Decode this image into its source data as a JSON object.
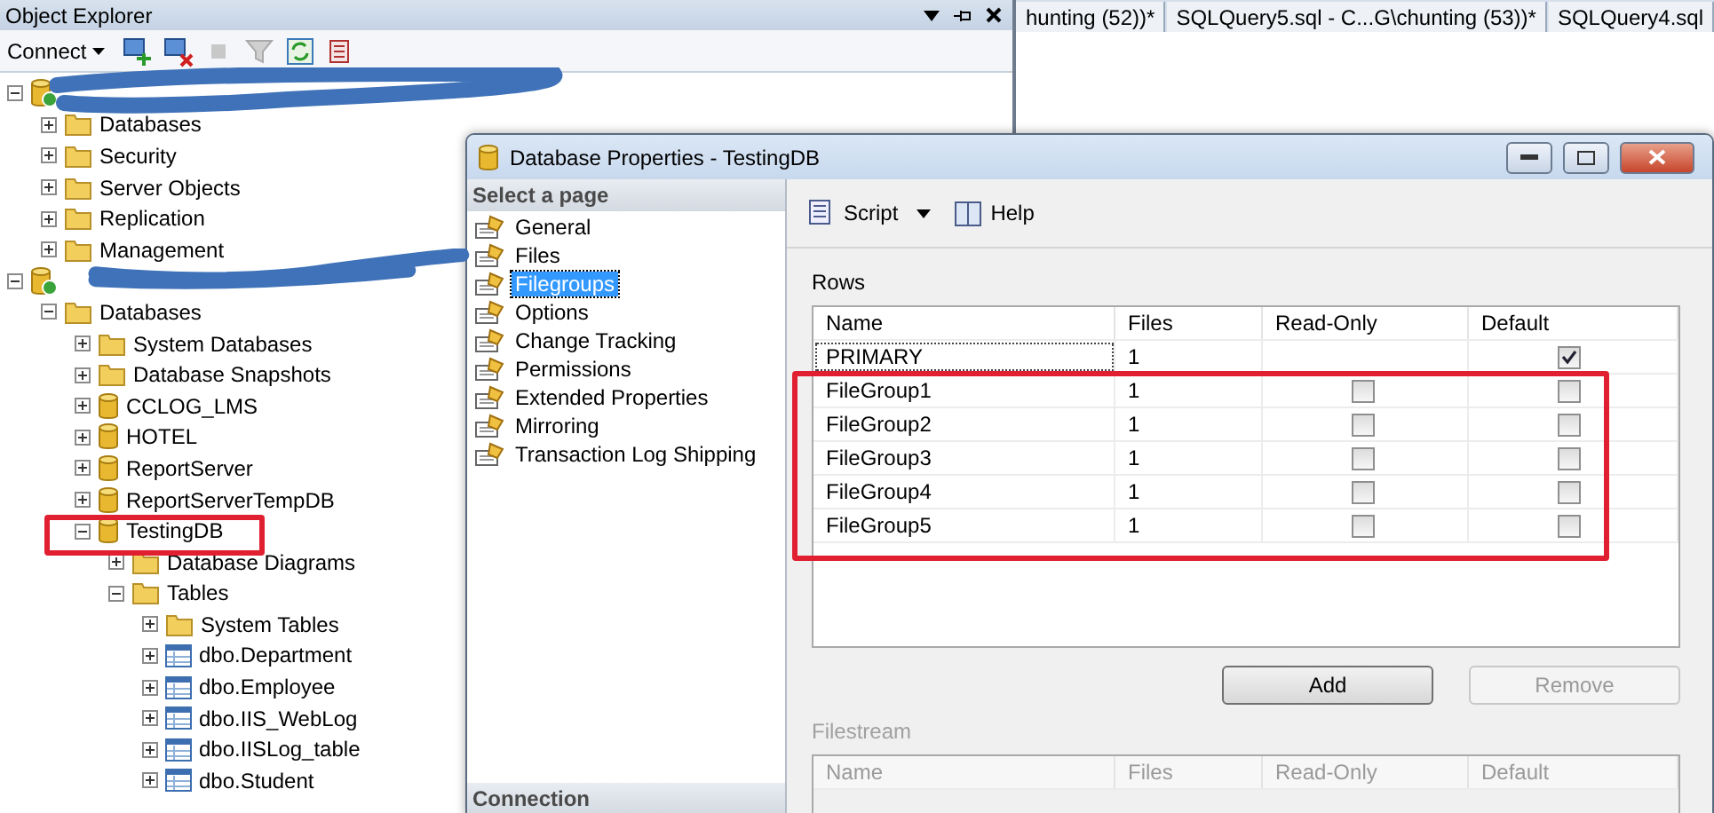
{
  "explorer": {
    "title": "Object Explorer",
    "connect_label": "Connect",
    "tree": [
      {
        "kind": "server",
        "expanded": true,
        "children": [
          {
            "label": "Databases",
            "kind": "folder",
            "expanded": false
          },
          {
            "label": "Security",
            "kind": "folder",
            "expanded": false
          },
          {
            "label": "Server Objects",
            "kind": "folder",
            "expanded": false
          },
          {
            "label": "Replication",
            "kind": "folder",
            "expanded": false
          },
          {
            "label": "Management",
            "kind": "folder",
            "expanded": false
          }
        ]
      },
      {
        "kind": "server",
        "expanded": true,
        "children": [
          {
            "label": "Databases",
            "kind": "folder",
            "expanded": true,
            "children": [
              {
                "label": "System Databases",
                "kind": "folder",
                "expanded": false
              },
              {
                "label": "Database Snapshots",
                "kind": "folder",
                "expanded": false
              },
              {
                "label": "CCLOG_LMS",
                "kind": "database",
                "expanded": false
              },
              {
                "label": "HOTEL",
                "kind": "database",
                "expanded": false
              },
              {
                "label": "ReportServer",
                "kind": "database",
                "expanded": false
              },
              {
                "label": "ReportServerTempDB",
                "kind": "database",
                "expanded": false
              },
              {
                "label": "TestingDB",
                "kind": "database",
                "expanded": true,
                "children": [
                  {
                    "label": "Database Diagrams",
                    "kind": "folder",
                    "expanded": false
                  },
                  {
                    "label": "Tables",
                    "kind": "folder",
                    "expanded": true,
                    "children": [
                      {
                        "label": "System Tables",
                        "kind": "folder",
                        "expanded": false
                      },
                      {
                        "label": "dbo.Department",
                        "kind": "table",
                        "expanded": false
                      },
                      {
                        "label": "dbo.Employee",
                        "kind": "table",
                        "expanded": false
                      },
                      {
                        "label": "dbo.IIS_WebLog",
                        "kind": "table",
                        "expanded": false
                      },
                      {
                        "label": "dbo.IISLog_table",
                        "kind": "table",
                        "expanded": false
                      },
                      {
                        "label": "dbo.Student",
                        "kind": "table",
                        "expanded": false
                      }
                    ]
                  }
                ]
              }
            ]
          }
        ]
      }
    ]
  },
  "editor_tabs": [
    {
      "label": "hunting (52))*",
      "selected": false
    },
    {
      "label": "SQLQuery5.sql - C...G\\chunting (53))*",
      "selected": false
    },
    {
      "label": "SQLQuery4.sql",
      "selected": false
    }
  ],
  "dialog": {
    "title": "Database Properties - TestingDB",
    "pages_header": "Select a page",
    "pages": [
      {
        "label": "General",
        "selected": false
      },
      {
        "label": "Files",
        "selected": false
      },
      {
        "label": "Filegroups",
        "selected": true
      },
      {
        "label": "Options",
        "selected": false
      },
      {
        "label": "Change Tracking",
        "selected": false
      },
      {
        "label": "Permissions",
        "selected": false
      },
      {
        "label": "Extended Properties",
        "selected": false
      },
      {
        "label": "Mirroring",
        "selected": false
      },
      {
        "label": "Transaction Log Shipping",
        "selected": false
      }
    ],
    "connection_header": "Connection",
    "script_label": "Script",
    "help_label": "Help",
    "rows_section": {
      "label": "Rows",
      "columns": [
        "Name",
        "Files",
        "Read-Only",
        "Default"
      ],
      "rows": [
        {
          "name": "PRIMARY",
          "files": "1",
          "default": true
        },
        {
          "name": "FileGroup1",
          "files": "1",
          "read_only": false,
          "default": false
        },
        {
          "name": "FileGroup2",
          "files": "1",
          "read_only": false,
          "default": false
        },
        {
          "name": "FileGroup3",
          "files": "1",
          "read_only": false,
          "default": false
        },
        {
          "name": "FileGroup4",
          "files": "1",
          "read_only": false,
          "default": false
        },
        {
          "name": "FileGroup5",
          "files": "1",
          "read_only": false,
          "default": false
        }
      ]
    },
    "buttons": [
      {
        "label": "Add",
        "disabled": false
      },
      {
        "label": "Remove",
        "disabled": true
      }
    ],
    "filestream_section": {
      "label": "Filestream",
      "columns": [
        "Name",
        "Files",
        "Read-Only",
        "Default"
      ]
    }
  }
}
